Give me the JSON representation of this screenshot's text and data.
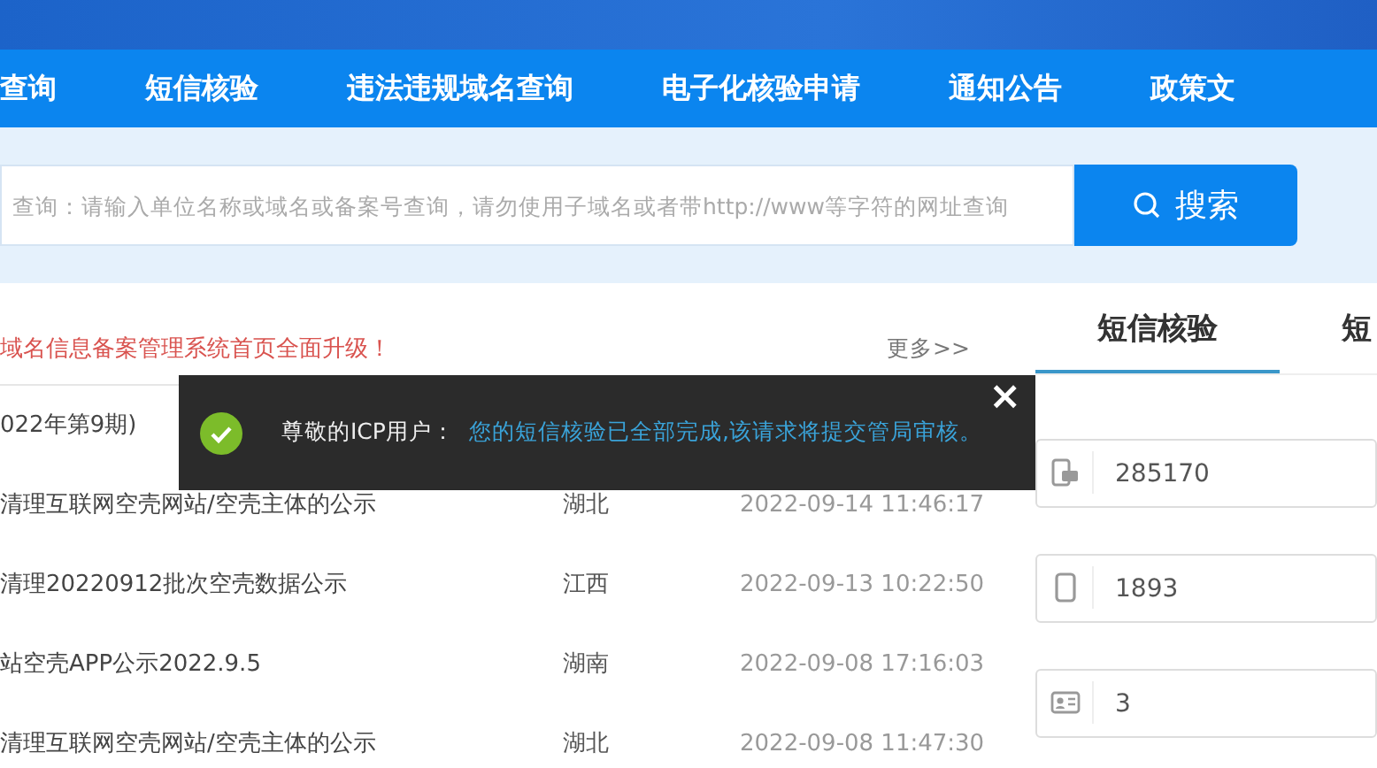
{
  "nav": [
    {
      "label": "查询"
    },
    {
      "label": "短信核验"
    },
    {
      "label": "违法违规域名查询"
    },
    {
      "label": "电子化核验申请"
    },
    {
      "label": "通知公告"
    },
    {
      "label": "政策文"
    }
  ],
  "search": {
    "placeholder": "查询：请输入单位名称或域名或备案号查询，请勿使用子域名或者带http://www等字符的网址查询",
    "button": "搜索"
  },
  "notices": {
    "headline": "域名信息备案管理系统首页全面升级！",
    "more": "更多>>",
    "rows": [
      {
        "title": "022年第9期)"
      },
      {
        "title": "清理互联网空壳网站/空壳主体的公示",
        "province": "湖北",
        "date": "2022-09-14 11:46:17"
      },
      {
        "title": "清理20220912批次空壳数据公示",
        "province": "江西",
        "date": "2022-09-13 10:22:50"
      },
      {
        "title": "站空壳APP公示2022.9.5",
        "province": "湖南",
        "date": "2022-09-08 17:16:03"
      },
      {
        "title": "清理互联网空壳网站/空壳主体的公示",
        "province": "湖北",
        "date": "2022-09-08 11:47:30"
      }
    ]
  },
  "sms_panel": {
    "tabs": [
      {
        "label": "短信核验",
        "selected": true
      },
      {
        "label": "短",
        "selected": false
      }
    ],
    "fields": [
      {
        "kind": "sms",
        "value": "285170"
      },
      {
        "kind": "phone",
        "value": "1893"
      },
      {
        "kind": "idcard",
        "value": "3"
      }
    ]
  },
  "toast": {
    "title": "尊敬的ICP用户：",
    "message": "您的短信核验已全部完成,该请求将提交管局审核。",
    "close": "×"
  }
}
